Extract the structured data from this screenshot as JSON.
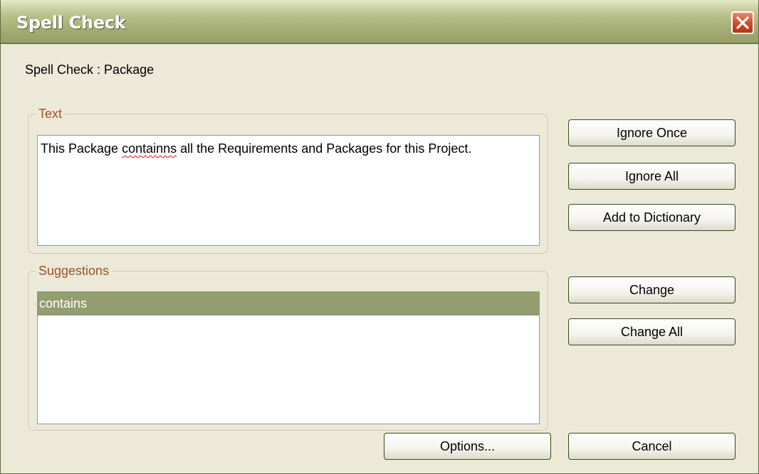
{
  "window": {
    "title": "Spell Check",
    "close_icon": "close-icon"
  },
  "header": {
    "subtitle": "Spell Check : Package"
  },
  "text_group": {
    "legend": "Text",
    "content_before": "This Package ",
    "misspelled_word": "containns",
    "content_after": " all the Requirements and Packages for this Project."
  },
  "suggestions_group": {
    "legend": "Suggestions",
    "items": [
      "contains"
    ],
    "selected_index": 0
  },
  "buttons": {
    "ignore_once": "Ignore Once",
    "ignore_all": "Ignore All",
    "add_to_dictionary": "Add to Dictionary",
    "change": "Change",
    "change_all": "Change All",
    "options": "Options...",
    "cancel": "Cancel"
  },
  "colors": {
    "title_bar": "#a3ad73",
    "legend_text": "#a0522d",
    "selection": "#939d6f",
    "misspelling_underline": "#e01010"
  }
}
